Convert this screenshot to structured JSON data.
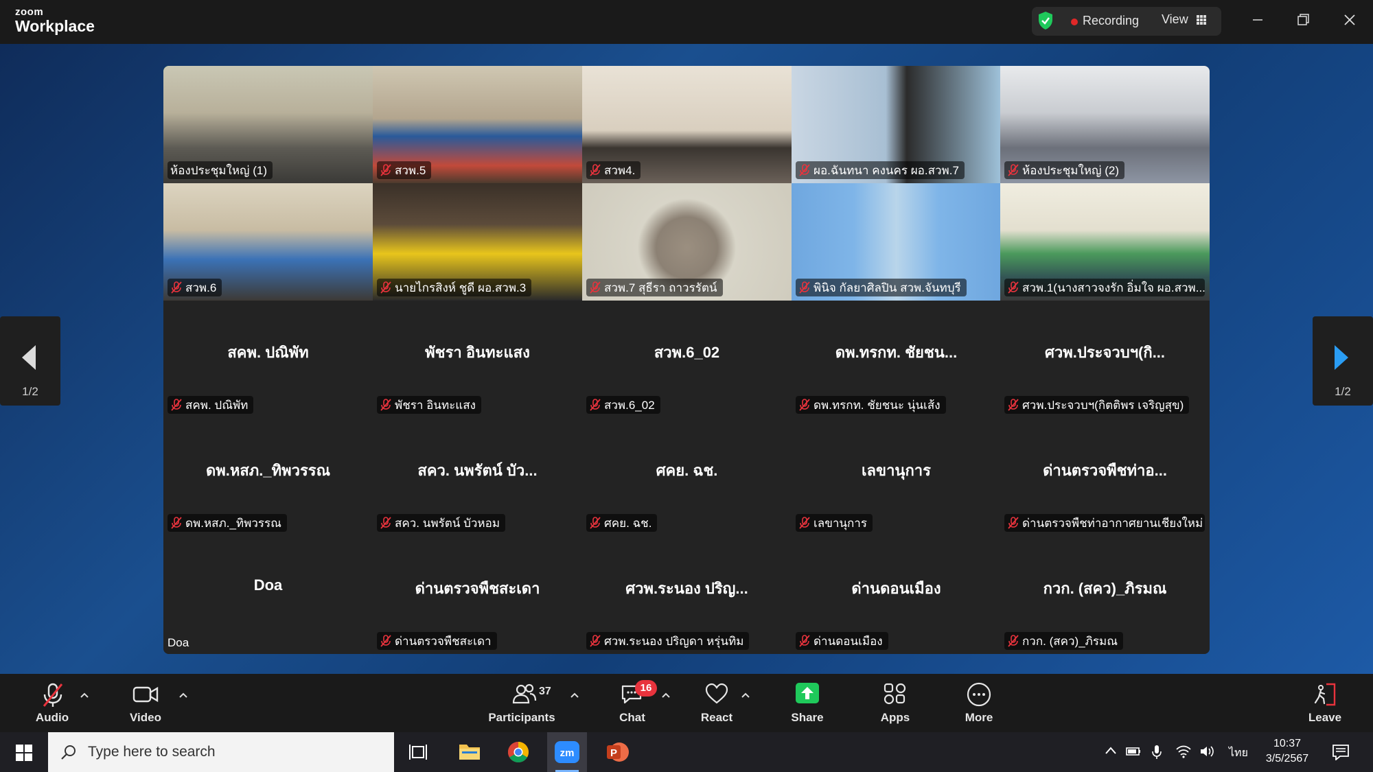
{
  "titlebar": {
    "brand_small": "zoom",
    "brand": "Workplace",
    "recording": "Recording",
    "view": "View"
  },
  "video_tiles": [
    {
      "label": "ห้องประชุมใหญ่ (1)"
    },
    {
      "label": "สวพ.5"
    },
    {
      "label": "สวพ4."
    },
    {
      "label": "ผอ.ฉันทนา คงนคร ผอ.สวพ.7"
    },
    {
      "label": "ห้องประชุมใหญ่ (2)"
    },
    {
      "label": "สวพ.6"
    },
    {
      "label": "นายไกรสิงห์ ชูดี ผอ.สวพ.3"
    },
    {
      "label": "สวพ.7 สุธีรา ถาวรรัตน์"
    },
    {
      "label": "พินิจ กัลยาศิลปิน สวพ.จันทบุรี"
    },
    {
      "label": "สวพ.1(นางสาวจงรัก อิ่มใจ ผอ.สวพ...."
    }
  ],
  "name_tiles": [
    {
      "name": "สคพ. ปณิพัท",
      "label": "สคพ. ปณิพัท"
    },
    {
      "name": "พัชรา อินทะแสง",
      "label": "พัชรา อินทะแสง"
    },
    {
      "name": "สวพ.6_02",
      "label": "สวพ.6_02"
    },
    {
      "name": "ดพ.ทรกท. ชัยชน...",
      "label": "ดพ.ทรกท. ชัยชนะ นุ่นเส้ง"
    },
    {
      "name": "ศวพ.ประจวบฯ(กิ...",
      "label": "ศวพ.ประจวบฯ(กิตติพร เจริญสุข)"
    },
    {
      "name": "ดพ.หสภ._ทิพวรรณ",
      "label": "ดพ.หสภ._ทิพวรรณ"
    },
    {
      "name": "สคว. นพรัตน์ บัว...",
      "label": "สคว. นพรัตน์ บัวหอม"
    },
    {
      "name": "ศคย. ฉช.",
      "label": "ศคย. ฉช."
    },
    {
      "name": "เลขานุการ",
      "label": "เลขานุการ"
    },
    {
      "name": "ด่านตรวจพืชท่าอ...",
      "label": "ด่านตรวจพืชท่าอากาศยานเชียงใหม่"
    },
    {
      "name": "Doa",
      "label": "Doa"
    },
    {
      "name": "ด่านตรวจพืชสะเดา",
      "label": "ด่านตรวจพืชสะเดา"
    },
    {
      "name": "ศวพ.ระนอง ปริญ...",
      "label": "ศวพ.ระนอง ปริญดา หรุ่นทิม"
    },
    {
      "name": "ด่านดอนเมือง",
      "label": "ด่านดอนเมือง"
    },
    {
      "name": "กวก. (สคว)_ภิรมณ",
      "label": "กวก. (สคว)_ภิรมณ"
    }
  ],
  "pagination": {
    "left": "1/2",
    "right": "1/2"
  },
  "toolbar": {
    "audio": "Audio",
    "video": "Video",
    "participants": "Participants",
    "participants_count": "37",
    "chat": "Chat",
    "chat_badge": "16",
    "react": "React",
    "share": "Share",
    "apps": "Apps",
    "more": "More",
    "leave": "Leave"
  },
  "taskbar": {
    "search_placeholder": "Type here to search",
    "language": "ไทย",
    "time": "10:37",
    "date": "3/5/2567"
  },
  "colors": {
    "active_speaker": "#27c15a",
    "recording_dot": "#e02828",
    "share_green": "#1fc95b",
    "chat_badge": "#e8333d",
    "muted_red": "#e8333d"
  }
}
